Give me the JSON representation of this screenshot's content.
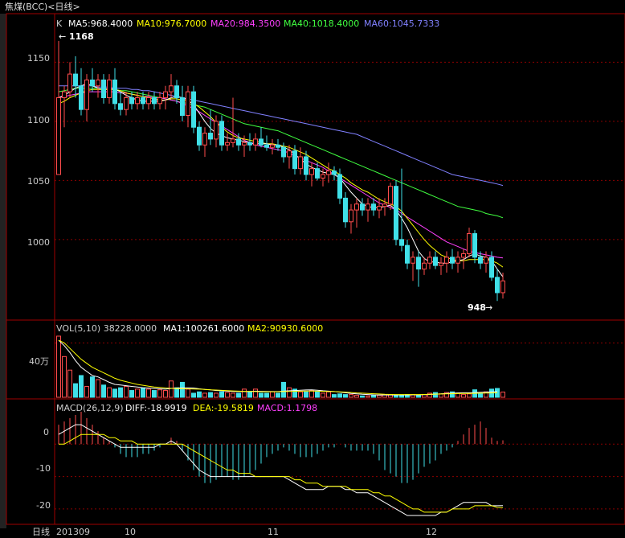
{
  "window": {
    "title": "焦煤(BCC)<日线>"
  },
  "colors": {
    "up": "#ff4d4d",
    "down": "#40e0e8",
    "ma5": "#ffffff",
    "ma10": "#ffff00",
    "ma20": "#ff40ff",
    "ma40": "#40ff40",
    "ma60": "#8080ff",
    "vol_ma1": "#ffffff",
    "vol_ma2": "#ffff00",
    "diff": "#ffffff",
    "dea": "#ffff00",
    "grid": "#8b0000",
    "frame": "#a00000"
  },
  "price_panel": {
    "k_label": "K",
    "ma5_text": "MA5:968.4000",
    "ma10_text": "MA10:976.7000",
    "ma20_text": "MA20:984.3500",
    "ma40_text": "MA40:1018.4000",
    "ma60_text": "MA60:1045.7333",
    "high_marker": "1168",
    "low_marker": "948",
    "y_ticks": [
      "1150",
      "1100",
      "1050",
      "1000"
    ]
  },
  "volume_panel": {
    "header_main": "VOL(5,10) 38228.0000",
    "ma1_text": "MA1:100261.6000",
    "ma2_text": "MA2:90930.6000",
    "y_tick": "40万"
  },
  "macd_panel": {
    "header_main": "MACD(26,12,9)",
    "diff_text": "DIFF:-18.9919",
    "dea_text": "DEA:-19.5819",
    "macd_text": "MACD:1.1798",
    "y_ticks": [
      "0",
      "-10",
      "-20"
    ]
  },
  "x_axis": {
    "period_label": "日线",
    "labels": [
      "201309",
      "10",
      "11",
      "12"
    ]
  },
  "chart_data": {
    "type": "candlestick",
    "title": "焦煤(BCC)<日线>",
    "price_range": [
      940,
      1170
    ],
    "candles": [
      [
        1055,
        1168,
        1055,
        1120
      ],
      [
        1120,
        1130,
        1095,
        1125
      ],
      [
        1125,
        1150,
        1120,
        1140
      ],
      [
        1140,
        1155,
        1120,
        1130
      ],
      [
        1130,
        1145,
        1105,
        1110
      ],
      [
        1110,
        1140,
        1100,
        1135
      ],
      [
        1135,
        1145,
        1125,
        1130
      ],
      [
        1130,
        1140,
        1120,
        1135
      ],
      [
        1135,
        1140,
        1115,
        1120
      ],
      [
        1120,
        1140,
        1115,
        1135
      ],
      [
        1135,
        1145,
        1110,
        1115
      ],
      [
        1115,
        1125,
        1105,
        1110
      ],
      [
        1110,
        1125,
        1105,
        1120
      ],
      [
        1120,
        1125,
        1110,
        1115
      ],
      [
        1115,
        1125,
        1110,
        1120
      ],
      [
        1120,
        1125,
        1110,
        1115
      ],
      [
        1115,
        1125,
        1110,
        1120
      ],
      [
        1120,
        1125,
        1110,
        1115
      ],
      [
        1115,
        1125,
        1110,
        1120
      ],
      [
        1120,
        1130,
        1110,
        1125
      ],
      [
        1125,
        1140,
        1120,
        1130
      ],
      [
        1130,
        1135,
        1115,
        1120
      ],
      [
        1120,
        1130,
        1100,
        1105
      ],
      [
        1105,
        1130,
        1095,
        1125
      ],
      [
        1125,
        1130,
        1090,
        1095
      ],
      [
        1095,
        1100,
        1075,
        1080
      ],
      [
        1080,
        1095,
        1070,
        1090
      ],
      [
        1090,
        1110,
        1080,
        1085
      ],
      [
        1085,
        1105,
        1078,
        1100
      ],
      [
        1100,
        1105,
        1075,
        1080
      ],
      [
        1080,
        1090,
        1075,
        1082
      ],
      [
        1082,
        1120,
        1078,
        1085
      ],
      [
        1085,
        1090,
        1075,
        1080
      ],
      [
        1080,
        1088,
        1070,
        1082
      ],
      [
        1082,
        1090,
        1075,
        1080
      ],
      [
        1080,
        1090,
        1075,
        1085
      ],
      [
        1085,
        1095,
        1078,
        1080
      ],
      [
        1080,
        1088,
        1075,
        1078
      ],
      [
        1078,
        1085,
        1072,
        1080
      ],
      [
        1080,
        1085,
        1075,
        1078
      ],
      [
        1078,
        1082,
        1065,
        1070
      ],
      [
        1070,
        1080,
        1060,
        1075
      ],
      [
        1075,
        1080,
        1055,
        1060
      ],
      [
        1060,
        1078,
        1055,
        1070
      ],
      [
        1070,
        1075,
        1050,
        1055
      ],
      [
        1055,
        1065,
        1045,
        1060
      ],
      [
        1060,
        1065,
        1050,
        1052
      ],
      [
        1052,
        1060,
        1045,
        1055
      ],
      [
        1055,
        1065,
        1048,
        1058
      ],
      [
        1058,
        1062,
        1050,
        1055
      ],
      [
        1055,
        1060,
        1030,
        1035
      ],
      [
        1035,
        1040,
        1010,
        1015
      ],
      [
        1015,
        1030,
        1005,
        1025
      ],
      [
        1025,
        1035,
        1010,
        1030
      ],
      [
        1030,
        1035,
        1020,
        1025
      ],
      [
        1025,
        1035,
        1015,
        1030
      ],
      [
        1030,
        1035,
        1020,
        1025
      ],
      [
        1025,
        1035,
        1018,
        1028
      ],
      [
        1028,
        1035,
        1020,
        1030
      ],
      [
        1030,
        1048,
        1025,
        1045
      ],
      [
        1045,
        1050,
        995,
        1000
      ],
      [
        1000,
        1060,
        990,
        995
      ],
      [
        995,
        1000,
        975,
        980
      ],
      [
        980,
        990,
        965,
        985
      ],
      [
        985,
        990,
        960,
        975
      ],
      [
        975,
        985,
        970,
        980
      ],
      [
        980,
        990,
        975,
        985
      ],
      [
        985,
        990,
        975,
        978
      ],
      [
        978,
        985,
        970,
        980
      ],
      [
        980,
        990,
        972,
        985
      ],
      [
        985,
        992,
        975,
        980
      ],
      [
        980,
        990,
        972,
        985
      ],
      [
        985,
        992,
        975,
        988
      ],
      [
        988,
        1010,
        985,
        1005
      ],
      [
        1005,
        1008,
        980,
        985
      ],
      [
        985,
        990,
        975,
        980
      ],
      [
        980,
        990,
        972,
        985
      ],
      [
        985,
        990,
        965,
        968
      ],
      [
        968,
        975,
        948,
        955
      ],
      [
        955,
        972,
        950,
        965
      ]
    ],
    "ma5": [
      1120,
      1122,
      1125,
      1128,
      1130,
      1132,
      1130,
      1128,
      1127,
      1128,
      1127,
      1125,
      1122,
      1120,
      1118,
      1117,
      1117,
      1117,
      1117,
      1118,
      1120,
      1121,
      1120,
      1118,
      1114,
      1107,
      1100,
      1094,
      1090,
      1088,
      1086,
      1085,
      1084,
      1083,
      1082,
      1081,
      1081,
      1081,
      1080,
      1080,
      1078,
      1076,
      1072,
      1068,
      1064,
      1061,
      1059,
      1057,
      1056,
      1055,
      1052,
      1046,
      1040,
      1035,
      1030,
      1028,
      1027,
      1027,
      1028,
      1029,
      1025,
      1018,
      1010,
      1000,
      990,
      984,
      981,
      981,
      980,
      980,
      981,
      982,
      983,
      986,
      988,
      986,
      985,
      982,
      975,
      968.4
    ],
    "ma10": [
      1115,
      1117,
      1120,
      1122,
      1124,
      1126,
      1127,
      1127,
      1127,
      1127,
      1127,
      1126,
      1124,
      1123,
      1122,
      1121,
      1120,
      1119,
      1118,
      1118,
      1119,
      1119,
      1118,
      1117,
      1115,
      1112,
      1108,
      1104,
      1099,
      1095,
      1091,
      1088,
      1086,
      1085,
      1084,
      1083,
      1082,
      1081,
      1081,
      1080,
      1079,
      1078,
      1076,
      1074,
      1072,
      1069,
      1066,
      1063,
      1060,
      1058,
      1055,
      1052,
      1048,
      1045,
      1042,
      1040,
      1037,
      1034,
      1032,
      1030,
      1028,
      1024,
      1018,
      1012,
      1006,
      1000,
      995,
      991,
      987,
      985,
      983,
      982,
      982,
      983,
      983,
      983,
      983,
      982,
      980,
      976.7
    ],
    "ma20": [
      1120,
      1121,
      1122,
      1123,
      1124,
      1125,
      1125,
      1125,
      1125,
      1125,
      1125,
      1124,
      1124,
      1123,
      1122,
      1121,
      1121,
      1120,
      1120,
      1119,
      1118,
      1117,
      1115,
      1113,
      1111,
      1108,
      1105,
      1102,
      1099,
      1096,
      1093,
      1090,
      1087,
      1084,
      1082,
      1080,
      1079,
      1078,
      1077,
      1076,
      1075,
      1073,
      1071,
      1069,
      1067,
      1065,
      1063,
      1061,
      1058,
      1055,
      1052,
      1049,
      1046,
      1043,
      1040,
      1037,
      1034,
      1031,
      1029,
      1027,
      1025,
      1022,
      1019,
      1016,
      1013,
      1010,
      1007,
      1004,
      1001,
      998,
      996,
      994,
      992,
      990,
      989,
      988,
      987,
      986,
      985,
      984.35
    ],
    "ma40": [
      1125,
      1126,
      1127,
      1128,
      1128,
      1128,
      1128,
      1128,
      1127,
      1127,
      1127,
      1126,
      1126,
      1125,
      1124,
      1123,
      1122,
      1121,
      1120,
      1119,
      1118,
      1117,
      1116,
      1115,
      1114,
      1113,
      1112,
      1110,
      1108,
      1106,
      1104,
      1102,
      1100,
      1098,
      1097,
      1096,
      1095,
      1094,
      1093,
      1092,
      1090,
      1088,
      1086,
      1084,
      1082,
      1080,
      1078,
      1076,
      1074,
      1072,
      1070,
      1068,
      1066,
      1064,
      1062,
      1060,
      1058,
      1056,
      1054,
      1052,
      1050,
      1048,
      1046,
      1044,
      1042,
      1040,
      1038,
      1036,
      1034,
      1032,
      1030,
      1028,
      1027,
      1026,
      1025,
      1024,
      1022,
      1021,
      1020,
      1018.4
    ],
    "ma60": [
      1130,
      1130,
      1130,
      1130,
      1130,
      1130,
      1130,
      1129,
      1129,
      1129,
      1128,
      1128,
      1128,
      1127,
      1127,
      1126,
      1126,
      1125,
      1124,
      1123,
      1122,
      1121,
      1120,
      1119,
      1118,
      1117,
      1116,
      1115,
      1114,
      1113,
      1112,
      1111,
      1110,
      1109,
      1108,
      1107,
      1106,
      1105,
      1104,
      1103,
      1102,
      1101,
      1100,
      1099,
      1098,
      1097,
      1096,
      1095,
      1094,
      1093,
      1092,
      1091,
      1090,
      1089,
      1087,
      1085,
      1083,
      1081,
      1079,
      1077,
      1075,
      1073,
      1071,
      1069,
      1067,
      1065,
      1063,
      1061,
      1059,
      1057,
      1055,
      1054,
      1053,
      1052,
      1051,
      1050,
      1049,
      1048,
      1047,
      1045.73
    ],
    "volume": [
      450000,
      300000,
      200000,
      100000,
      160000,
      80000,
      150000,
      130000,
      90000,
      70000,
      60000,
      70000,
      80000,
      50000,
      60000,
      70000,
      60000,
      50000,
      55000,
      50000,
      120000,
      70000,
      110000,
      60000,
      30000,
      40000,
      30000,
      35000,
      30000,
      40000,
      35000,
      30000,
      30000,
      60000,
      40000,
      60000,
      30000,
      30000,
      40000,
      30000,
      110000,
      70000,
      60000,
      40000,
      40000,
      50000,
      40000,
      30000,
      40000,
      20000,
      25000,
      20000,
      20000,
      15000,
      10000,
      10000,
      15000,
      15000,
      20000,
      20000,
      15000,
      15000,
      20000,
      20000,
      15000,
      20000,
      30000,
      35000,
      25000,
      35000,
      40000,
      30000,
      20000,
      25000,
      55000,
      30000,
      40000,
      60000,
      65000,
      38228
    ],
    "vol_ma1": [
      420000,
      380000,
      330000,
      270000,
      220000,
      190000,
      160000,
      150000,
      130000,
      110000,
      95000,
      90000,
      85000,
      80000,
      75000,
      70000,
      68000,
      65000,
      62000,
      60000,
      65000,
      68000,
      70000,
      70000,
      68000,
      62000,
      58000,
      55000,
      50000,
      48000,
      45000,
      43000,
      42000,
      42000,
      43000,
      45000,
      44000,
      43000,
      42000,
      42000,
      45000,
      48000,
      50000,
      52000,
      54000,
      55000,
      52000,
      48000,
      45000,
      42000,
      38000,
      33000,
      28000,
      25000,
      22000,
      20000,
      18000,
      17000,
      17000,
      17000,
      17000,
      17000,
      17000,
      18000,
      18000,
      19000,
      21000,
      23000,
      25000,
      28000,
      30000,
      32000,
      33000,
      33000,
      35000,
      36000,
      38000,
      40000,
      42000,
      100261.6
    ],
    "vol_ma2": [
      420000,
      400000,
      360000,
      320000,
      280000,
      250000,
      220000,
      200000,
      180000,
      160000,
      140000,
      125000,
      115000,
      105000,
      95000,
      88000,
      82000,
      76000,
      72000,
      68000,
      66000,
      64000,
      63000,
      62000,
      61000,
      60000,
      58000,
      55000,
      53000,
      51000,
      49000,
      47000,
      45000,
      44000,
      43000,
      42000,
      41000,
      41000,
      41000,
      41000,
      42000,
      43000,
      44000,
      45000,
      46000,
      46000,
      45000,
      44000,
      43000,
      42000,
      40000,
      38000,
      35000,
      32000,
      30000,
      28000,
      26000,
      24000,
      22000,
      21000,
      20000,
      20000,
      20000,
      20000,
      20000,
      21000,
      22000,
      23000,
      24000,
      25000,
      26000,
      27000,
      28000,
      28000,
      29000,
      30000,
      31000,
      32000,
      33000,
      90930.6
    ],
    "macd": [
      6,
      7,
      8,
      9,
      10,
      8,
      6,
      4,
      2,
      1,
      -1,
      -3,
      -4,
      -4,
      -4,
      -3,
      -3,
      -2,
      -1,
      0,
      2,
      1,
      -2,
      -5,
      -8,
      -10,
      -12,
      -12,
      -11,
      -10,
      -10,
      -11,
      -11,
      -10,
      -9,
      -8,
      -6,
      -4,
      -3,
      -2,
      -1,
      -2,
      -3,
      -4,
      -4,
      -4,
      -3,
      -2,
      -1,
      -1,
      0,
      -1,
      -2,
      -2,
      -2,
      -2,
      -3,
      -5,
      -8,
      -9,
      -10,
      -12,
      -12,
      -11,
      -9,
      -7,
      -6,
      -5,
      -3,
      -2,
      -1,
      1,
      3,
      5,
      6,
      7,
      5,
      2,
      1,
      1.1798
    ],
    "diff": [
      3,
      4,
      5,
      6,
      6,
      5,
      4,
      3,
      2,
      1,
      0,
      -1,
      -1,
      -1,
      -1,
      -1,
      -1,
      -1,
      0,
      0,
      1,
      0,
      -2,
      -4,
      -6,
      -8,
      -9,
      -10,
      -10,
      -10,
      -10,
      -10,
      -10,
      -10,
      -10,
      -10,
      -10,
      -10,
      -10,
      -10,
      -10,
      -11,
      -12,
      -13,
      -14,
      -14,
      -14,
      -14,
      -13,
      -13,
      -13,
      -14,
      -14,
      -15,
      -15,
      -15,
      -16,
      -17,
      -18,
      -19,
      -20,
      -21,
      -22,
      -22,
      -22,
      -22,
      -22,
      -22,
      -21,
      -21,
      -20,
      -19,
      -18,
      -18,
      -18,
      -18,
      -18,
      -19,
      -19,
      -18.9919
    ],
    "dea": [
      0,
      0,
      1,
      2,
      3,
      3,
      3,
      3,
      3,
      2,
      2,
      1,
      1,
      1,
      0,
      0,
      0,
      0,
      0,
      0,
      0,
      0,
      0,
      -1,
      -2,
      -3,
      -4,
      -5,
      -6,
      -7,
      -8,
      -8,
      -9,
      -9,
      -9,
      -10,
      -10,
      -10,
      -10,
      -10,
      -10,
      -10,
      -11,
      -11,
      -12,
      -12,
      -12,
      -13,
      -13,
      -13,
      -13,
      -13,
      -14,
      -14,
      -14,
      -14,
      -15,
      -15,
      -16,
      -16,
      -17,
      -18,
      -19,
      -20,
      -20,
      -21,
      -21,
      -21,
      -21,
      -21,
      -20,
      -20,
      -20,
      -20,
      -19,
      -19,
      -19,
      -19,
      -19.5,
      -19.5819
    ],
    "macd_range": [
      -23,
      10
    ],
    "x_labels": [
      "201309",
      "10",
      "11",
      "12"
    ]
  }
}
